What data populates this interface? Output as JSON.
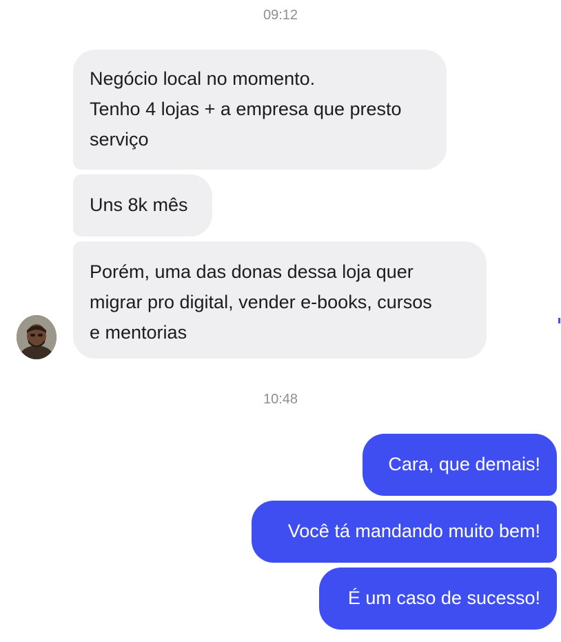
{
  "conversation": {
    "timestamp_1": "09:12",
    "incoming": [
      {
        "lines": [
          "Negócio local no momento.",
          "Tenho 4 lojas + a empresa que presto",
          "serviço"
        ]
      },
      {
        "lines": [
          "Uns 8k mês"
        ]
      },
      {
        "lines": [
          "Porém, uma das donas dessa loja quer",
          "migrar pro digital, vender e-books, cursos",
          "e mentorias"
        ]
      }
    ],
    "timestamp_2": "10:48",
    "outgoing": [
      {
        "text": "Cara, que demais!"
      },
      {
        "text": "Você tá mandando muito bem!"
      },
      {
        "text": "É um caso de sucesso!"
      }
    ]
  },
  "colors": {
    "incoming_bubble": "#efeff1",
    "outgoing_bubble": "#3e4ef0",
    "timestamp": "#8e8e93"
  },
  "icons": {
    "contact_avatar": "avatar-photo"
  }
}
